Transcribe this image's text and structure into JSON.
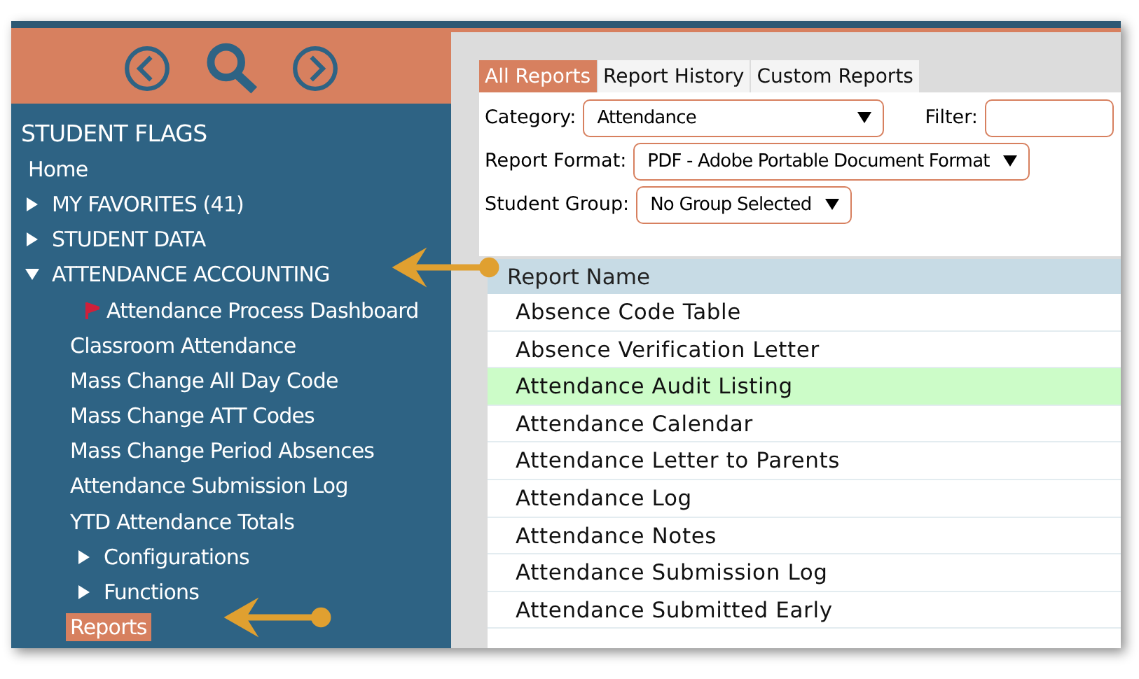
{
  "sidebar": {
    "nav": [
      {
        "kind": "back"
      },
      {
        "kind": "search"
      },
      {
        "kind": "forward"
      }
    ],
    "items": [
      {
        "kind": "heading",
        "label": "STUDENT FLAGS"
      },
      {
        "kind": "link",
        "label": "Home",
        "selected": false
      },
      {
        "kind": "group",
        "label": "MY FAVORITES (41)",
        "expanded": false
      },
      {
        "kind": "group",
        "label": "STUDENT DATA",
        "expanded": false
      },
      {
        "kind": "group",
        "label": "ATTENDANCE ACCOUNTING",
        "expanded": true,
        "children": [
          {
            "kind": "link",
            "label": "Attendance Process Dashboard",
            "flagged": true,
            "selected": false
          },
          {
            "kind": "link",
            "label": "Classroom Attendance",
            "selected": false
          },
          {
            "kind": "link",
            "label": "Mass Change All Day Code",
            "selected": false
          },
          {
            "kind": "link",
            "label": "Mass Change ATT Codes",
            "selected": false
          },
          {
            "kind": "link",
            "label": "Mass Change Period Absences",
            "selected": false
          },
          {
            "kind": "link",
            "label": "Attendance Submission Log",
            "selected": false
          },
          {
            "kind": "link",
            "label": "YTD Attendance Totals",
            "selected": false
          },
          {
            "kind": "group",
            "label": "Configurations",
            "expanded": false
          },
          {
            "kind": "group",
            "label": "Functions",
            "expanded": false
          },
          {
            "kind": "link",
            "label": "Reports",
            "selected": true
          }
        ]
      }
    ]
  },
  "tabs": [
    {
      "label": "All Reports",
      "selected": true
    },
    {
      "label": "Report History",
      "selected": false
    },
    {
      "label": "Custom Reports",
      "selected": false
    }
  ],
  "filters": [
    {
      "label": "Category:",
      "value": "Attendance",
      "kind": "select",
      "filter_label": "Filter:"
    },
    {
      "label": "Report Format:",
      "value": "PDF - Adobe Portable Document Format",
      "kind": "select"
    },
    {
      "label": "Student Group:",
      "value": "No Group Selected",
      "kind": "select"
    }
  ],
  "table": {
    "columns": [
      "Report Name"
    ],
    "rows": [
      {
        "name": "Absence Code Table",
        "selected": false
      },
      {
        "name": "Absence Verification Letter",
        "selected": false
      },
      {
        "name": "Attendance Audit Listing",
        "selected": true
      },
      {
        "name": "Attendance Calendar",
        "selected": false
      },
      {
        "name": "Attendance Letter to Parents",
        "selected": false
      },
      {
        "name": "Attendance Log",
        "selected": false
      },
      {
        "name": "Attendance Notes",
        "selected": false
      },
      {
        "name": "Attendance Submission Log",
        "selected": false
      },
      {
        "name": "Attendance Submitted Early",
        "selected": false
      }
    ]
  }
}
